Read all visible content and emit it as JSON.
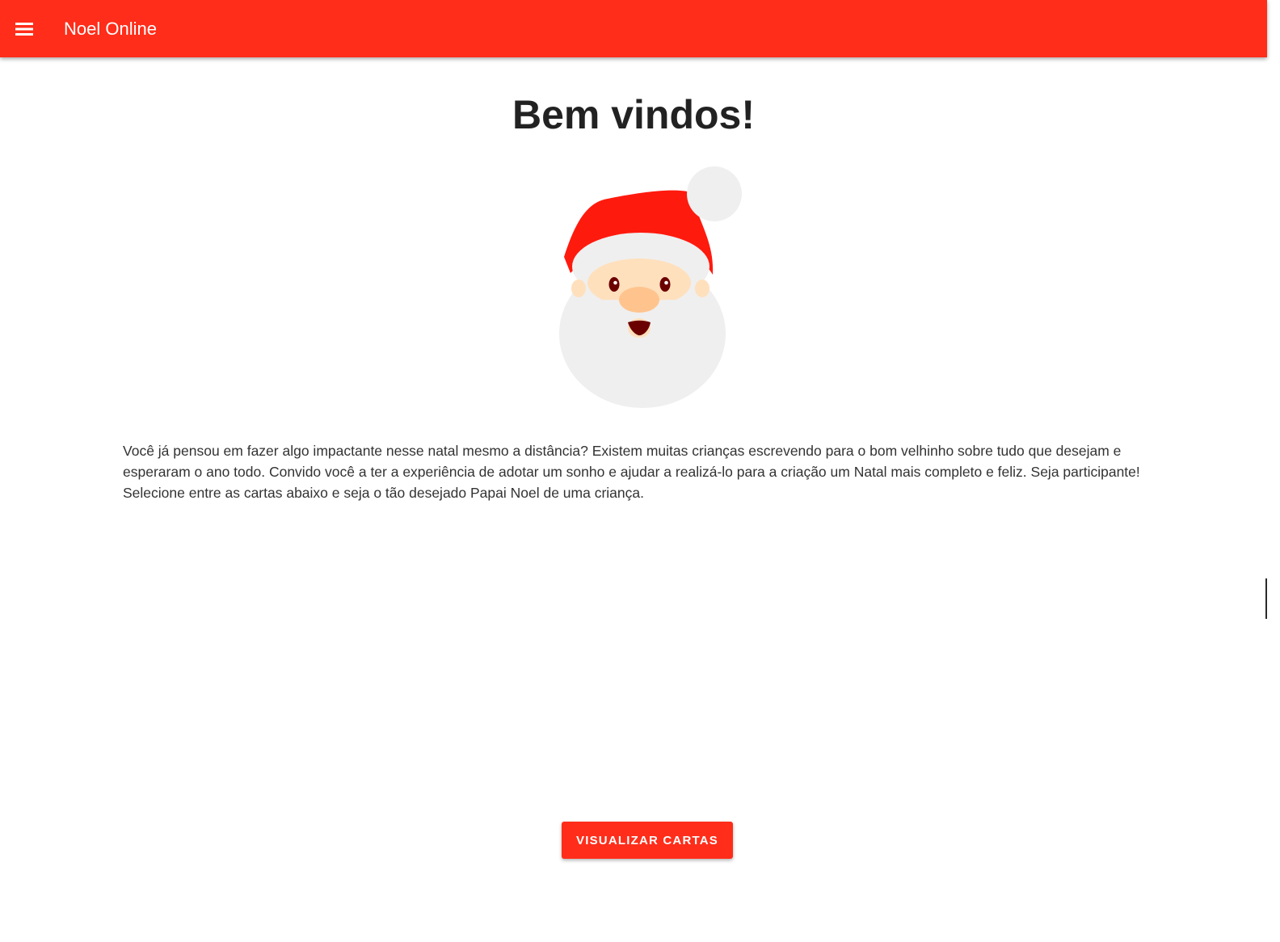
{
  "header": {
    "menu_icon": "hamburger-menu-icon",
    "title": "Noel Online"
  },
  "main": {
    "heading": "Bem vindos!",
    "illustration_icon": "santa-claus-face",
    "intro": "Você já pensou em fazer algo impactante nesse natal mesmo a distância? Existem muitas crianças escrevendo para o bom velhinho sobre tudo que desejam e esperaram o ano todo. Convido você a ter a experiência de adotar um sonho e ajudar a realizá-lo para a criação um Natal mais completo e feliz. Seja participante! Selecione entre as cartas abaixo e seja o tão desejado Papai Noel de uma criança.",
    "cta_label": "VISUALIZAR CARTAS"
  },
  "colors": {
    "primary": "#ff2d1a",
    "hat_red": "#ff1a0e",
    "beard": "#efefef",
    "skin": "#ffe0bd",
    "nose": "#ffc48e",
    "eye": "#6b0000"
  }
}
